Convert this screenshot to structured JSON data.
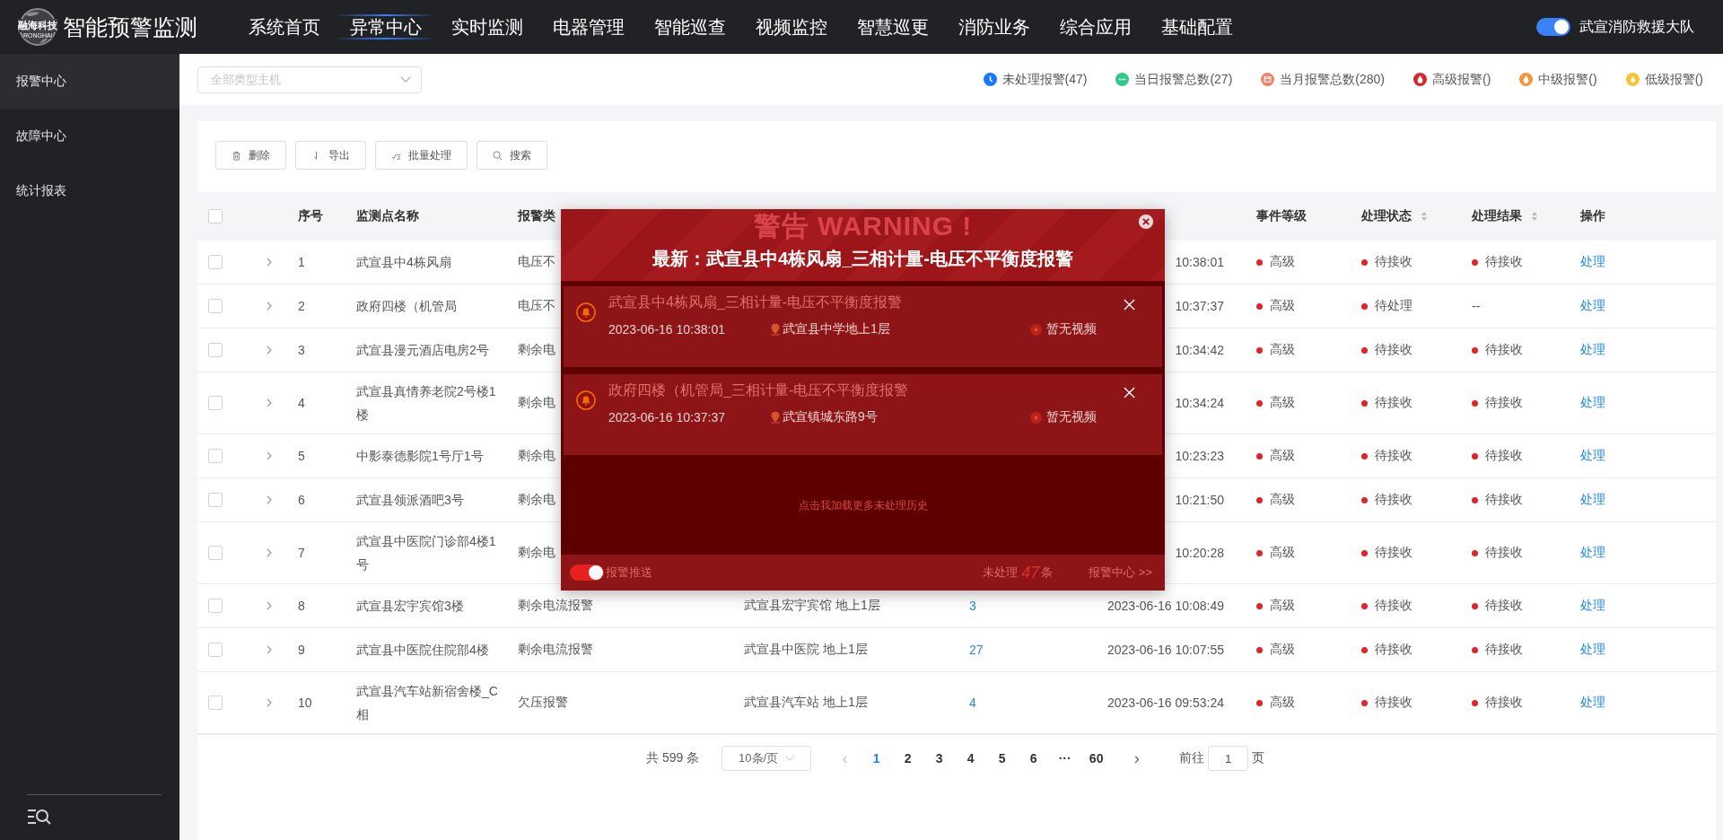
{
  "header": {
    "logo_text": "融海科技",
    "logo_sub": "RONGHAI",
    "app_title": "智能预警监测",
    "nav": [
      {
        "label": "系统首页",
        "selected": false
      },
      {
        "label": "异常中心",
        "selected": true
      },
      {
        "label": "实时监测",
        "selected": false
      },
      {
        "label": "电器管理",
        "selected": false
      },
      {
        "label": "智能巡查",
        "selected": false
      },
      {
        "label": "视频监控",
        "selected": false
      },
      {
        "label": "智慧巡更",
        "selected": false
      },
      {
        "label": "消防业务",
        "selected": false
      },
      {
        "label": "综合应用",
        "selected": false
      },
      {
        "label": "基础配置",
        "selected": false
      }
    ],
    "toggle": {
      "on": true
    },
    "org": "武宣消防救援大队"
  },
  "sidebar": {
    "items": [
      {
        "label": "报警中心",
        "selected": true
      },
      {
        "label": "故障中心",
        "selected": false
      },
      {
        "label": "统计报表",
        "selected": false
      }
    ]
  },
  "filter": {
    "placeholder": "全部类型主机"
  },
  "stats": [
    {
      "kind": "clock",
      "label": "未处理报警(47)",
      "color": "#1677ff"
    },
    {
      "kind": "dots",
      "label": "当日报警总数(27)",
      "color": "#2ec98a"
    },
    {
      "kind": "calendar",
      "label": "当月报警总数(280)",
      "color": "#f2806c"
    },
    {
      "kind": "flame",
      "label": "高级报警()",
      "color": "#d9262b"
    },
    {
      "kind": "flame",
      "label": "中级报警()",
      "color": "#f5943a"
    },
    {
      "kind": "drop",
      "label": "低级报警()",
      "color": "#f7c531"
    }
  ],
  "toolbar": [
    {
      "kind": "delete",
      "label": "删除"
    },
    {
      "kind": "export",
      "label": "导出"
    },
    {
      "kind": "batch",
      "label": "批量处理"
    },
    {
      "kind": "search",
      "label": "搜索"
    }
  ],
  "table": {
    "select_all": {
      "checked": false
    },
    "columns": [
      {
        "label": "序号",
        "sortable": false
      },
      {
        "label": "监测点名称",
        "sortable": false
      },
      {
        "label": "报警类",
        "sortable": false
      },
      {
        "label": "事件等级",
        "sortable": false
      },
      {
        "label": "处理状态",
        "sortable": true
      },
      {
        "label": "处理结果",
        "sortable": true
      },
      {
        "label": "操作",
        "sortable": false
      }
    ],
    "rows": [
      {
        "checked": false,
        "no": "1",
        "name": "武宣县中4栋风扇",
        "type": "电压不",
        "time": "10:38:01",
        "level": "高级",
        "status": "待接收",
        "result": "待接收",
        "result_dot": true,
        "action": "处理"
      },
      {
        "checked": false,
        "no": "2",
        "name": "政府四楼（机管局",
        "type": "电压不",
        "time": "10:37:37",
        "level": "高级",
        "status": "待处理",
        "result": "--",
        "result_dot": false,
        "action": "处理"
      },
      {
        "checked": false,
        "no": "3",
        "name": "武宣县漫元酒店电房2号",
        "type": "剩余电",
        "time": "10:34:42",
        "level": "高级",
        "status": "待接收",
        "result": "待接收",
        "result_dot": true,
        "action": "处理"
      },
      {
        "checked": false,
        "no": "4",
        "name": "武宣县真情养老院2号楼1楼",
        "type": "剩余电",
        "time": "10:34:24",
        "level": "高级",
        "status": "待接收",
        "result": "待接收",
        "result_dot": true,
        "action": "处理"
      },
      {
        "checked": false,
        "no": "5",
        "name": "中影泰德影院1号厅1号",
        "type": "剩余电",
        "time": "10:23:23",
        "level": "高级",
        "status": "待接收",
        "result": "待接收",
        "result_dot": true,
        "action": "处理"
      },
      {
        "checked": false,
        "no": "6",
        "name": "武宣县领派酒吧3号",
        "type": "剩余电",
        "time": "10:21:50",
        "level": "高级",
        "status": "待接收",
        "result": "待接收",
        "result_dot": true,
        "action": "处理"
      },
      {
        "checked": false,
        "no": "7",
        "name": "武宣县中医院门诊部4楼1号",
        "type": "剩余电",
        "time": "10:20:28",
        "level": "高级",
        "status": "待接收",
        "result": "待接收",
        "result_dot": true,
        "action": "处理"
      },
      {
        "checked": false,
        "no": "8",
        "name": "武宣县宏宇宾馆3楼",
        "type": "剩余电流报警",
        "location": "武宣县宏宇宾馆 地上1层",
        "count": "3",
        "time": "2023-06-16 10:08:49",
        "level": "高级",
        "status": "待接收",
        "result": "待接收",
        "result_dot": true,
        "action": "处理"
      },
      {
        "checked": false,
        "no": "9",
        "name": "武宣县中医院住院部4楼",
        "type": "剩余电流报警",
        "location": "武宣县中医院 地上1层",
        "count": "27",
        "time": "2023-06-16 10:07:55",
        "level": "高级",
        "status": "待接收",
        "result": "待接收",
        "result_dot": true,
        "action": "处理"
      },
      {
        "checked": false,
        "no": "10",
        "name": "武宣县汽车站新宿舍楼_C相",
        "type": "欠压报警",
        "location": "武宣县汽车站 地上1层",
        "count": "4",
        "time": "2023-06-16 09:53:24",
        "level": "高级",
        "status": "待接收",
        "result": "待接收",
        "result_dot": true,
        "action": "处理"
      }
    ]
  },
  "pagination": {
    "total": "共 599 条",
    "page_size": "10条/页",
    "prev": "‹",
    "pages": [
      {
        "label": "1",
        "selected": true
      },
      {
        "label": "2",
        "selected": false
      },
      {
        "label": "3",
        "selected": false
      },
      {
        "label": "4",
        "selected": false
      },
      {
        "label": "5",
        "selected": false
      },
      {
        "label": "6",
        "selected": false
      },
      {
        "label": "···",
        "selected": false
      },
      {
        "label": "60",
        "selected": false
      }
    ],
    "next": "›",
    "goto_label": "前往",
    "goto_value": "1",
    "goto_suffix": "页"
  },
  "modal": {
    "title": "警告 WARNING !",
    "headline": "最新：武宣县中4栋风扇_三相计量-电压不平衡度报警",
    "alerts": [
      {
        "title": "武宣县中4栋风扇_三相计量-电压不平衡度报警",
        "time": "2023-06-16 10:38:01",
        "location": "武宣县中学地上1层",
        "video": "暂无视频"
      },
      {
        "title": "政府四楼（机管局_三相计量-电压不平衡度报警",
        "time": "2023-06-16 10:37:37",
        "location": "武宣镇城东路9号",
        "video": "暂无视频"
      }
    ],
    "load_more": "点击我加载更多未处理历史",
    "push": {
      "label": "报警推送",
      "on": true
    },
    "pending_prefix": "未处理",
    "pending_count": "47",
    "pending_suffix": "条",
    "center_link": "报警中心 >>"
  }
}
